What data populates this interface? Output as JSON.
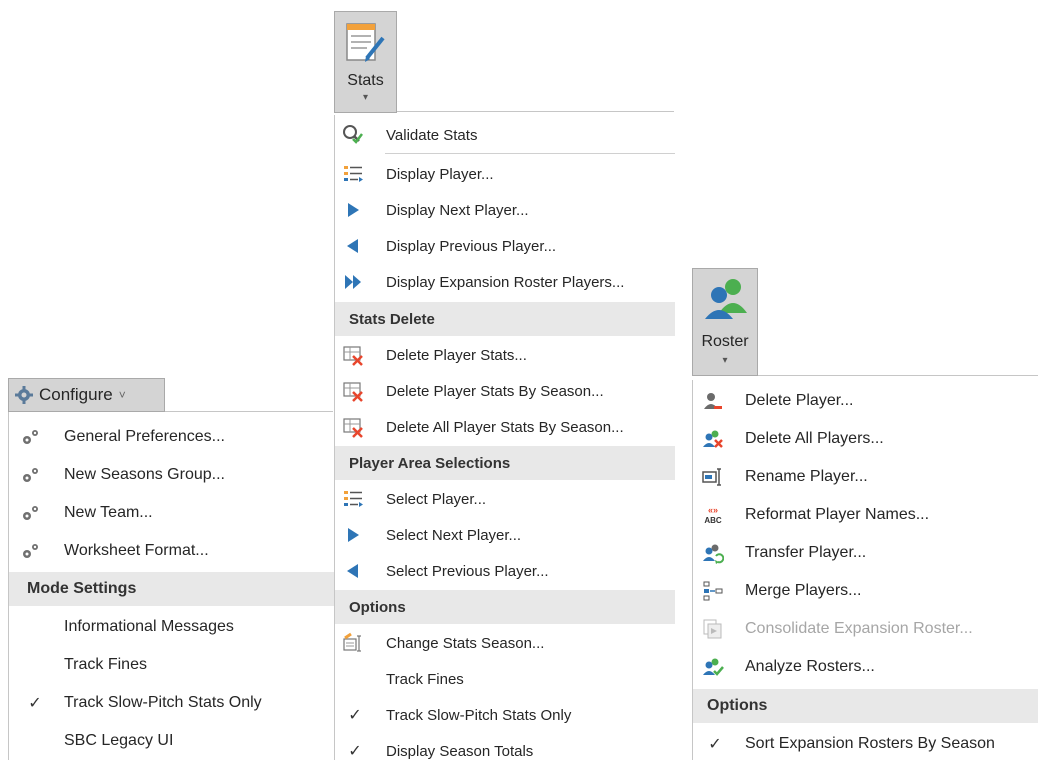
{
  "configure": {
    "button_label": "Configure",
    "chevron": "˅",
    "items": [
      {
        "label": "General Preferences...",
        "icon": "gears-icon"
      },
      {
        "label": "New Seasons Group...",
        "icon": "gears-icon"
      },
      {
        "label": "New Team...",
        "icon": "gears-icon"
      },
      {
        "label": "Worksheet Format...",
        "icon": "gears-icon"
      }
    ],
    "mode_header": "Mode Settings",
    "mode_items": [
      {
        "label": "Informational Messages",
        "checked": false
      },
      {
        "label": "Track Fines",
        "checked": false
      },
      {
        "label": "Track Slow-Pitch Stats Only",
        "checked": true
      },
      {
        "label": "SBC Legacy UI",
        "checked": false
      }
    ]
  },
  "stats": {
    "button_label": "Stats",
    "chevron": "▾",
    "items": [
      {
        "label": "Validate Stats",
        "icon": "validate-icon"
      },
      {
        "label": "Display Player...",
        "icon": "list-icon"
      },
      {
        "label": "Display Next Player...",
        "icon": "play-right-icon"
      },
      {
        "label": "Display Previous Player...",
        "icon": "play-left-icon"
      },
      {
        "label": "Display Expansion Roster Players...",
        "icon": "fast-forward-icon"
      }
    ],
    "delete_header": "Stats Delete",
    "delete_items": [
      {
        "label": "Delete Player Stats...",
        "icon": "delete-stats-icon"
      },
      {
        "label": "Delete Player Stats By Season...",
        "icon": "delete-stats-icon"
      },
      {
        "label": "Delete All Player Stats By Season...",
        "icon": "delete-stats-icon"
      }
    ],
    "area_header": "Player Area Selections",
    "area_items": [
      {
        "label": "Select Player...",
        "icon": "list-icon"
      },
      {
        "label": "Select Next Player...",
        "icon": "play-right-icon"
      },
      {
        "label": "Select Previous Player...",
        "icon": "play-left-icon"
      }
    ],
    "options_header": "Options",
    "options_items": [
      {
        "label": "Change Stats Season...",
        "icon": "change-season-icon"
      },
      {
        "label": "Track Fines",
        "checked": false
      },
      {
        "label": "Track Slow-Pitch Stats Only",
        "checked": true
      },
      {
        "label": "Display Season Totals",
        "checked": true
      }
    ]
  },
  "roster": {
    "button_label": "Roster",
    "chevron": "▾",
    "items": [
      {
        "label": "Delete Player...",
        "icon": "delete-player-icon",
        "disabled": false
      },
      {
        "label": "Delete All Players...",
        "icon": "delete-all-players-icon",
        "disabled": false
      },
      {
        "label": "Rename Player...",
        "icon": "rename-icon",
        "disabled": false
      },
      {
        "label": "Reformat Player Names...",
        "icon": "reformat-abc-icon",
        "disabled": false
      },
      {
        "label": "Transfer Player...",
        "icon": "transfer-icon",
        "disabled": false
      },
      {
        "label": "Merge Players...",
        "icon": "merge-icon",
        "disabled": false
      },
      {
        "label": "Consolidate Expansion Roster...",
        "icon": "consolidate-icon",
        "disabled": true
      },
      {
        "label": "Analyze Rosters...",
        "icon": "analyze-icon",
        "disabled": false
      }
    ],
    "options_header": "Options",
    "options_items": [
      {
        "label": "Sort Expansion Rosters By Season",
        "checked": true
      }
    ]
  },
  "colors": {
    "accent_blue": "#2e75b6",
    "delete_red": "#e8452c",
    "green": "#4caf50",
    "header_bg": "#e8e8e8",
    "ribbon_button_bg": "#d4d4d4"
  },
  "check_glyph": "✓"
}
